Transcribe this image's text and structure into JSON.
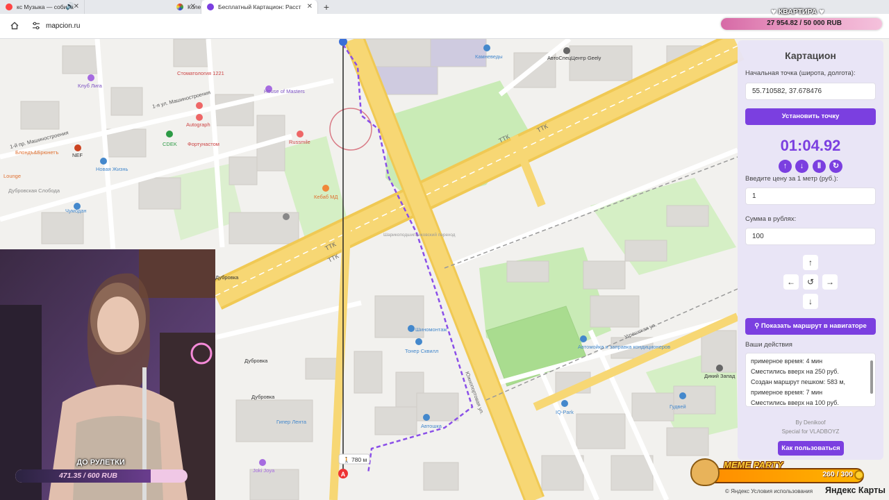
{
  "browser": {
    "tabs": [
      {
        "title": "кс Музыка — собира",
        "active": false
      },
      {
        "title": "Колесо случайного выбора - /",
        "active": false
      },
      {
        "title": "Бесплатный Картацион: Расст",
        "active": true
      }
    ],
    "new_tab_glyph": "+",
    "url": "mapcion.ru"
  },
  "goal": {
    "title": "КВАРТИРА",
    "amount": "27 954.82 / 50 000 RUB",
    "progress": 0.559
  },
  "map": {
    "route_distance": "780 м",
    "start_marker": "A",
    "labels": [
      "Стоматология 1221",
      "Клуб Лига",
      "1-я ул. Машиностроения",
      "1-й пр. Машиностроения",
      "House of Masters",
      "Autograph",
      "Фортунастом",
      "CDEK",
      "Russmile",
      "NEF",
      "Новая Жизнь",
      "Блондъ&Брюнетъ",
      "Дубровская Слобода",
      "Lounge",
      "Чумодан",
      "Кебаб МД",
      "ТТК",
      "Дубровка",
      "Шиномонтаж",
      "Тонер Сквилл",
      "Автомойка и заправка кондиционеров",
      "Угрешская ул.",
      "Южнопортовая ул.",
      "Гипер Лента",
      "Автошка",
      "IQ-Park",
      "Гудвей",
      "Дикий Запад",
      "Joki Joya",
      "Камневеды",
      "АвтоСпецЦентр Geely",
      "Шарикоподшипниковский переход"
    ],
    "attribution": "© Яндекс Условия использования",
    "brand": "Яндекс Карты"
  },
  "panel": {
    "title": "Картацион",
    "start_label": "Начальная точка (широта, долгота):",
    "start_value": "55.710582, 37.678476",
    "set_point_button": "Установить точку",
    "timer": "01:04.92",
    "price_label": "Введите цену за 1 метр (руб.):",
    "price_value": "1",
    "sum_label": "Сумма в рублях:",
    "sum_value": "100",
    "navigator_button": "Показать маршрут в навигаторе",
    "actions_label": "Ваши действия",
    "log": [
      "примерное время: 4 мин",
      "Сместились вверх на 250 руб.",
      "Создан маршрут пешком: 583 м,",
      "примерное время: 7 мин",
      "Сместились вверх на 100 руб."
    ],
    "credit_author": "By Denikoof",
    "credit_special": "Special for VLADBOYZ",
    "how_button": "Как пользоваться"
  },
  "stream": {
    "roulette_label": "ДО РУЛЕТКИ",
    "roulette_amount": "471.35 / 600 RUB",
    "roulette_progress": 0.786,
    "meme_title": "MEME PARTY",
    "meme_count": "260 / 300"
  },
  "colors": {
    "accent": "#7b3fe0",
    "route": "#8a4fe8",
    "road_major": "#f7d774",
    "park": "#c9ebb6"
  }
}
